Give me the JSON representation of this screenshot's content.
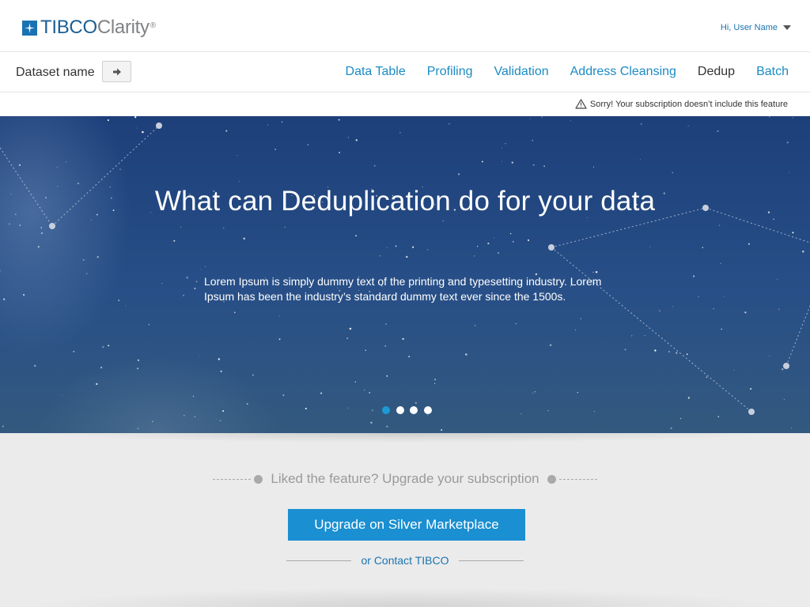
{
  "header": {
    "logo_brand": "TIBCO",
    "logo_product": "Clarity",
    "logo_mark": "®",
    "user_greeting": "Hi, User Name"
  },
  "nav": {
    "dataset_label": "Dataset name",
    "tabs": [
      {
        "label": "Data Table",
        "active": false
      },
      {
        "label": "Profiling",
        "active": false
      },
      {
        "label": "Validation",
        "active": false
      },
      {
        "label": "Address Cleansing",
        "active": false
      },
      {
        "label": "Dedup",
        "active": true
      },
      {
        "label": "Batch",
        "active": false
      }
    ]
  },
  "notice": {
    "text": "Sorry! Your subscription doesn’t include this feature",
    "icon": "warning-icon"
  },
  "hero": {
    "title": "What can Deduplication do for your data",
    "body": "Lorem Ipsum is simply dummy text of the printing and typesetting industry. Lorem Ipsum has been the industry’s standard dummy text ever since the 1500s.",
    "carousel": {
      "count": 4,
      "active_index": 0
    }
  },
  "upgrade": {
    "prompt": "Liked the feature? Upgrade your subscription",
    "button_label": "Upgrade on Silver Marketplace",
    "contact_label": "or Contact TIBCO"
  },
  "colors": {
    "accent": "#1a8fd1",
    "link": "#1b8bc4",
    "brand": "#1a5f96",
    "hero_sky": "#264b84"
  }
}
